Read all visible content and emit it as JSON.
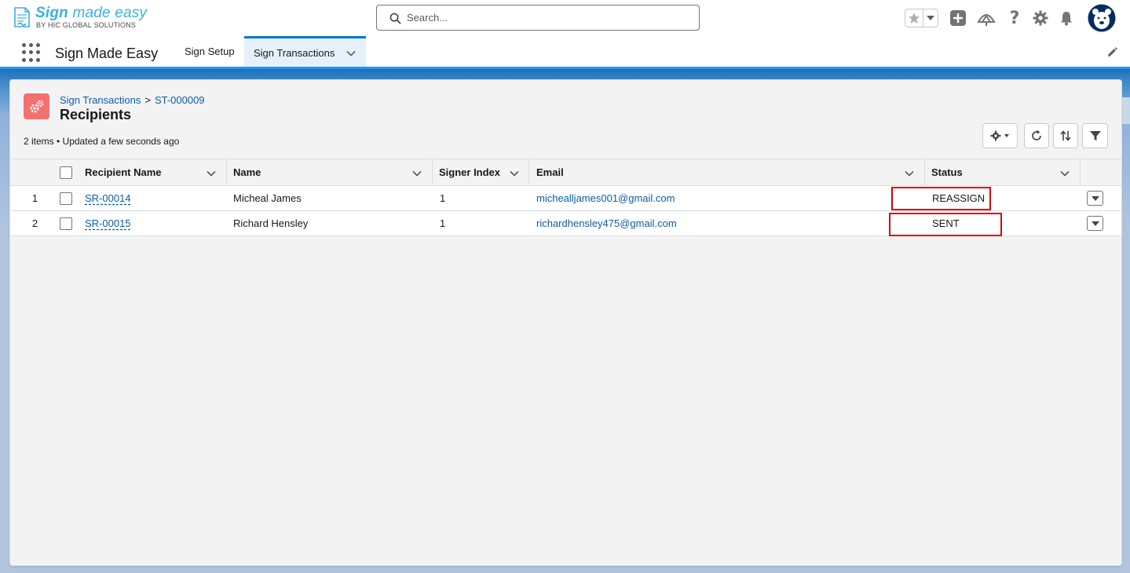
{
  "brand": {
    "logo_title_bold": "Sign",
    "logo_title_rest": "made easy",
    "logo_subtitle": "BY HIC GLOBAL SOLUTIONS"
  },
  "search": {
    "placeholder": "Search..."
  },
  "global_actions": {
    "icons": [
      "favorites-star-icon",
      "add-icon",
      "trailhead-icon",
      "help-icon",
      "setup-gear-icon",
      "notifications-bell-icon",
      "avatar"
    ]
  },
  "app_nav": {
    "app_name": "Sign Made Easy",
    "tabs": [
      {
        "label": "Sign Setup",
        "active": false
      },
      {
        "label": "Sign Transactions",
        "active": true
      }
    ]
  },
  "page": {
    "breadcrumb": {
      "parent": "Sign Transactions",
      "separator": ">",
      "record": "ST-000009"
    },
    "title": "Recipients",
    "meta": "2 items • Updated a few seconds ago"
  },
  "table": {
    "columns": [
      "Recipient Name",
      "Name",
      "Signer Index",
      "Email",
      "Status"
    ],
    "rows": [
      {
        "num": "1",
        "recipient": "SR-00014",
        "name": "Micheal James",
        "signer_index": "1",
        "email": "michealljames001@gmail.com",
        "status": "REASSIGN"
      },
      {
        "num": "2",
        "recipient": "SR-00015",
        "name": "Richard Hensley",
        "signer_index": "1",
        "email": "richardhensley475@gmail.com",
        "status": "SENT"
      }
    ]
  },
  "colors": {
    "accent": "#0176d3",
    "link": "#0b5cab",
    "object_icon": "#f2716f",
    "highlight_box": "#e00000",
    "logo": "#3ab0e2"
  }
}
